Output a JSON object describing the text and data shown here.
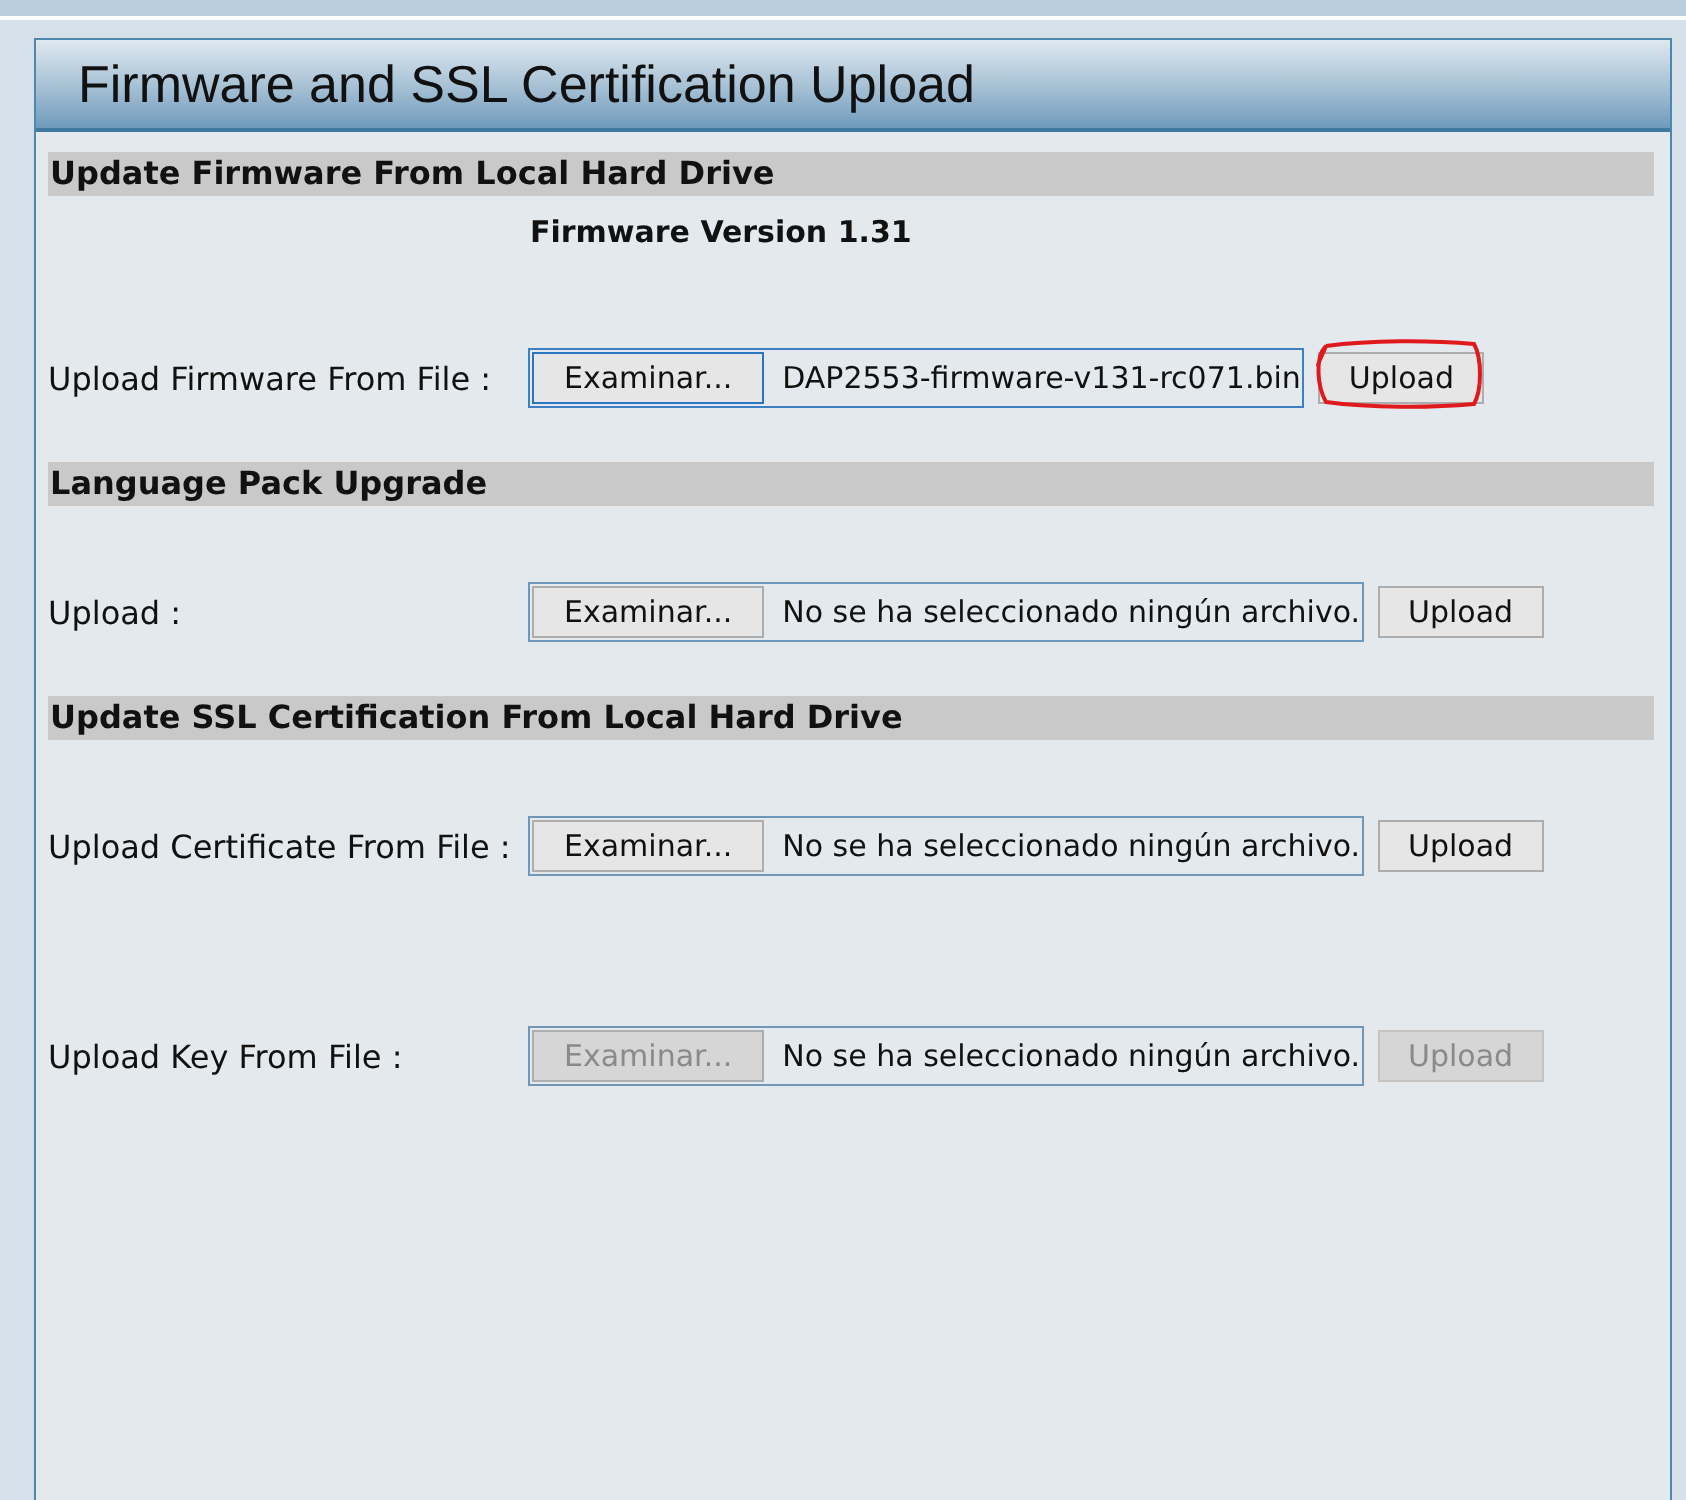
{
  "window": {
    "title": "Firmware and SSL Certification Upload"
  },
  "sections": [
    {
      "title": "Update Firmware From Local Hard Drive",
      "version": "Firmware Version 1.31",
      "rows": [
        {
          "label": "Upload Firmware From File :",
          "browse": "Examinar...",
          "file": "DAP2553-firmware-v131-rc071.bin",
          "upload": "Upload",
          "disabled": false,
          "focused": true,
          "circled": true
        }
      ]
    },
    {
      "title": "Language Pack Upgrade",
      "rows": [
        {
          "label": "Upload :",
          "browse": "Examinar...",
          "file": "No se ha seleccionado ningún archivo.",
          "upload": "Upload",
          "disabled": false,
          "focused": false,
          "circled": false
        }
      ]
    },
    {
      "title": "Update SSL Certification From Local Hard Drive",
      "rows": [
        {
          "label": "Upload Certificate From File :",
          "browse": "Examinar...",
          "file": "No se ha seleccionado ningún archivo.",
          "upload": "Upload",
          "disabled": false,
          "focused": false,
          "circled": false
        },
        {
          "label": "Upload Key From File :",
          "browse": "Examinar...",
          "file": "No se ha seleccionado ningún archivo.",
          "upload": "Upload",
          "disabled": true,
          "focused": false,
          "circled": false
        }
      ]
    }
  ]
}
